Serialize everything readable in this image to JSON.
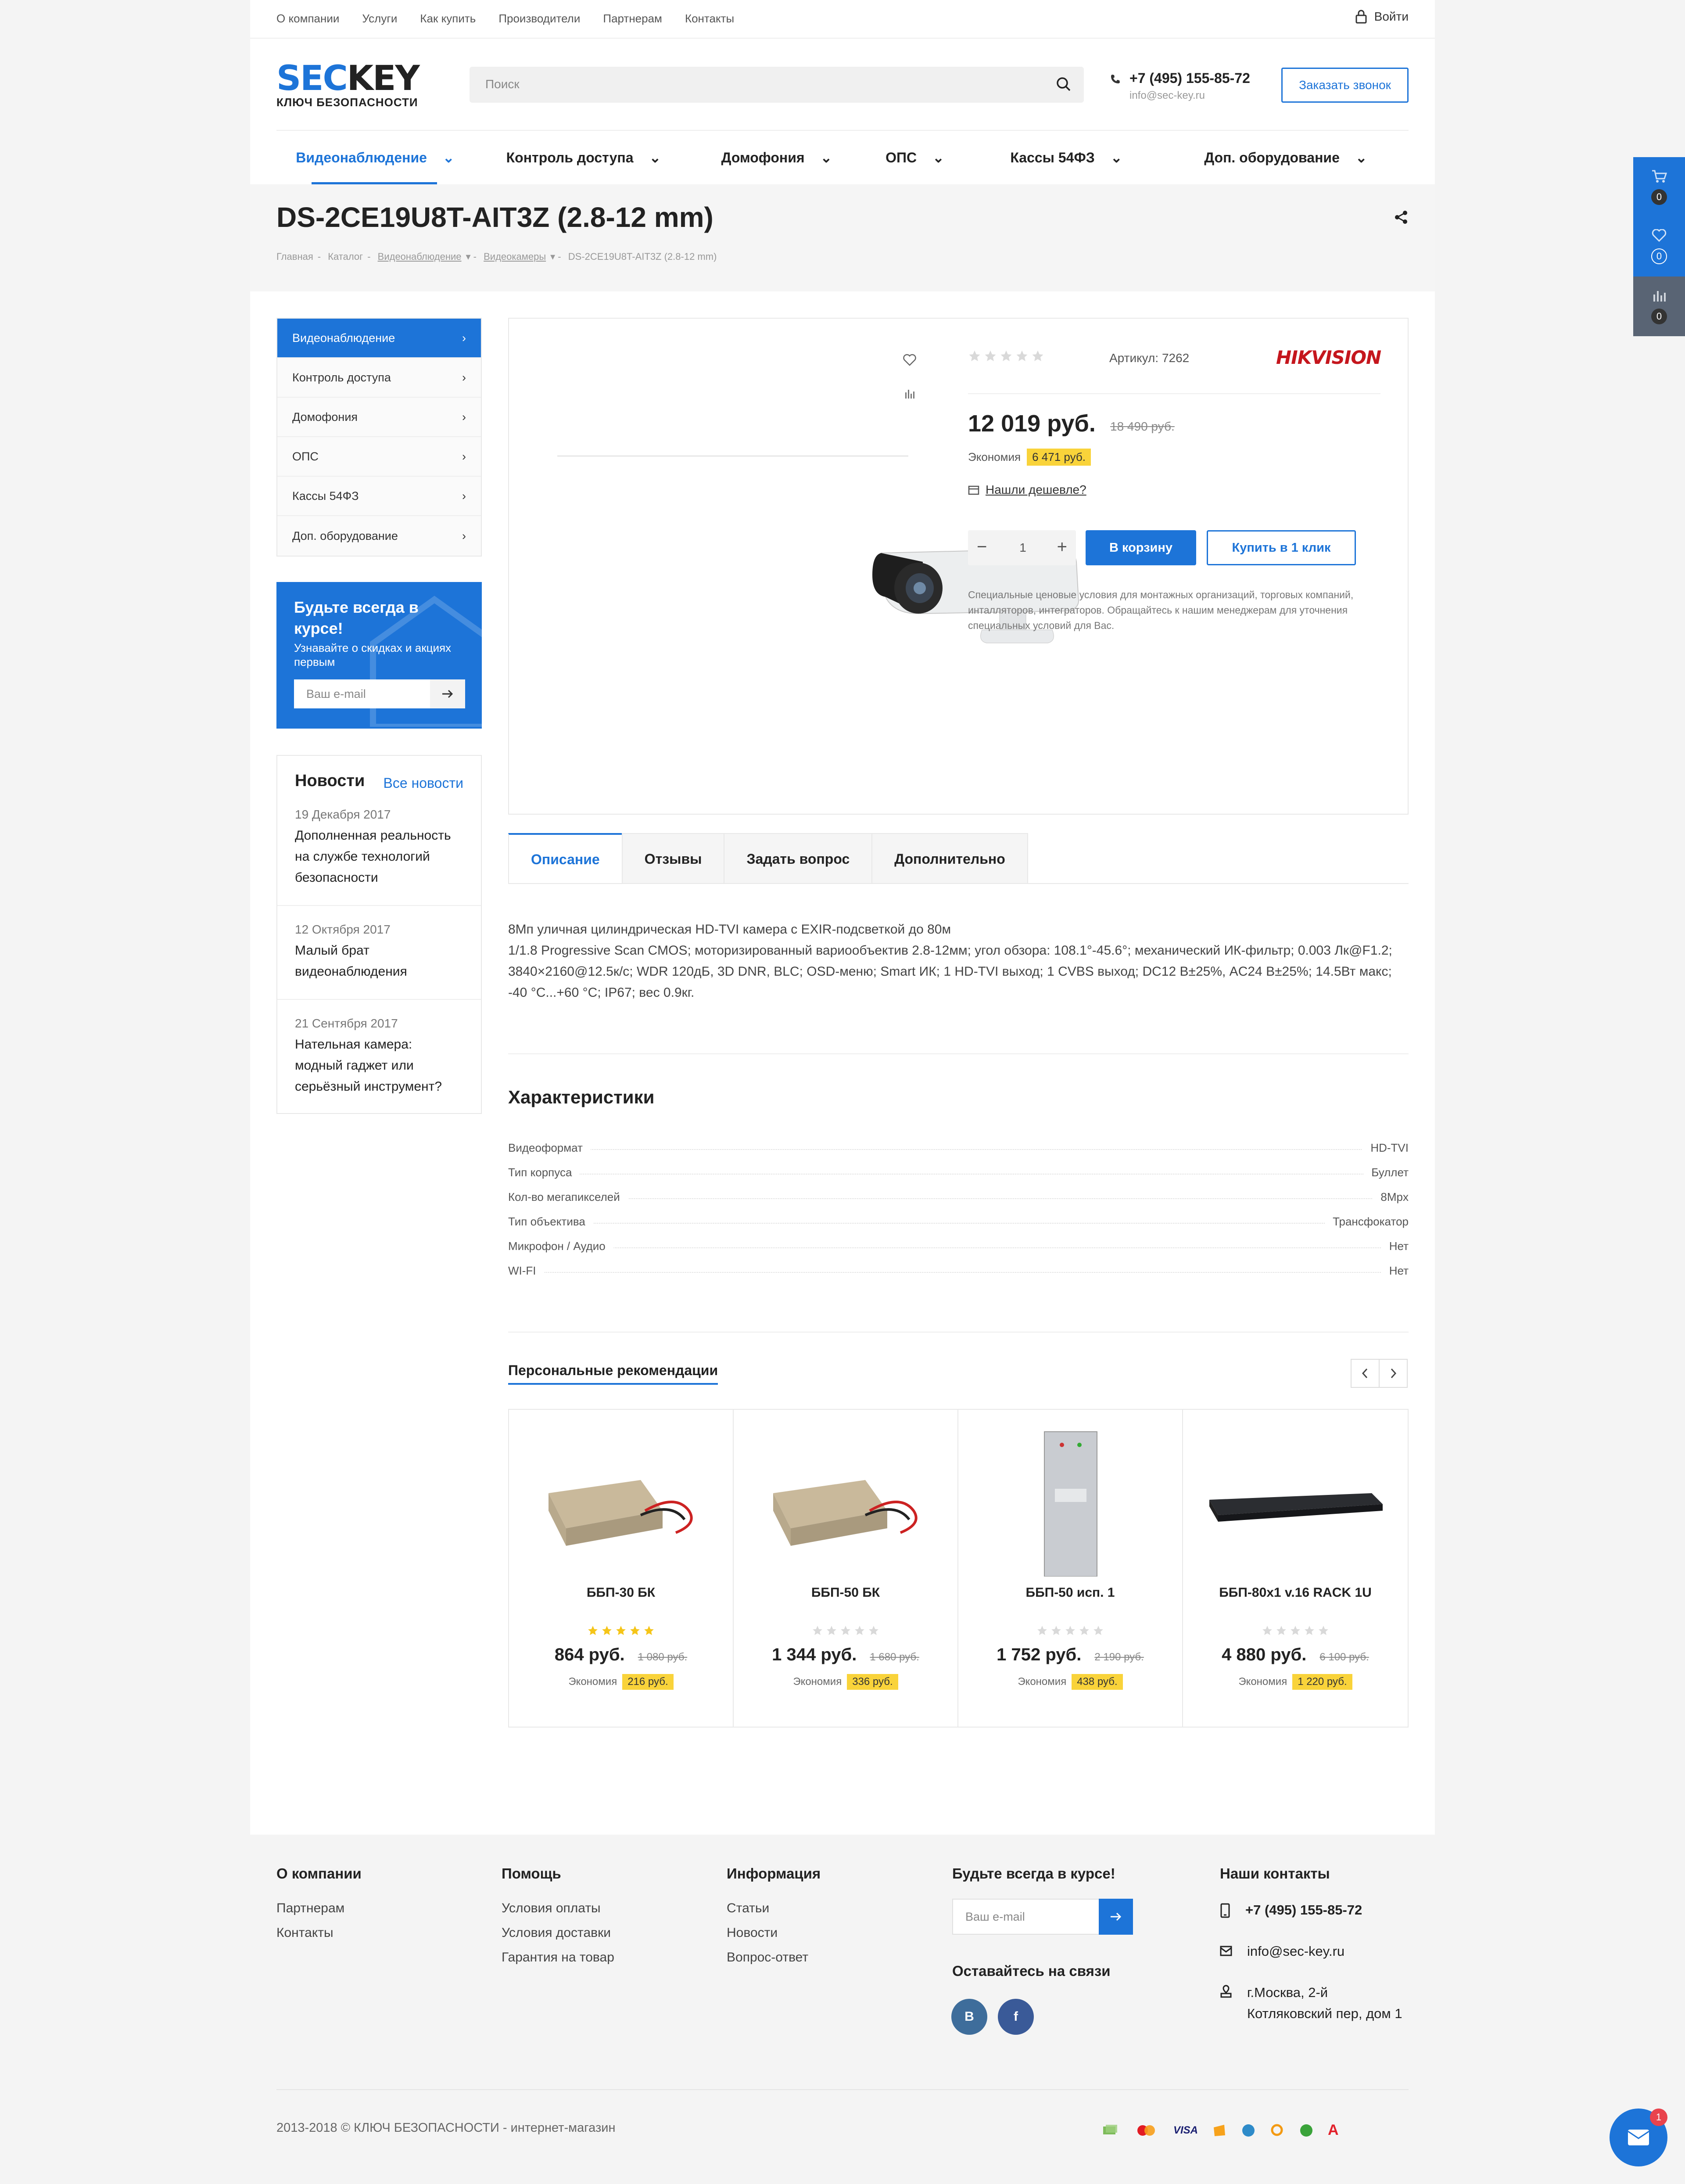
{
  "topnav": {
    "links": [
      "О компании",
      "Услуги",
      "Как купить",
      "Производители",
      "Партнерам",
      "Контакты"
    ],
    "login": "Войти"
  },
  "logo": {
    "brand_a": "SEC",
    "brand_b": "KEY",
    "tagline": "КЛЮЧ БЕЗОПАСНОСТИ"
  },
  "search": {
    "placeholder": "Поиск"
  },
  "contact": {
    "phone": "+7 (495) 155-85-72",
    "email": "info@sec-key.ru",
    "callback": "Заказать звонок"
  },
  "mainmenu": [
    "Видеонаблюдение",
    "Контроль доступа",
    "Домофония",
    "ОПС",
    "Кассы 54ФЗ",
    "Доп. оборудование"
  ],
  "product": {
    "title": "DS-2CE19U8T-AIT3Z (2.8-12 mm)",
    "breadcrumbs": [
      "Главная",
      "Каталог",
      "Видеонаблюдение",
      "Видеокамеры",
      "DS-2CE19U8T-AIT3Z (2.8-12 mm)"
    ],
    "artikul": "Артикул: 7262",
    "brand": "HIKVISION",
    "price": "12 019 руб.",
    "old_price": "18 490 руб.",
    "economy_label": "Экономия",
    "economy_value": "6 471 руб.",
    "cheaper": "Нашли дешевле?",
    "qty": "1",
    "cart_btn": "В корзину",
    "oneclick_btn": "Купить в 1 клик",
    "special": "Специальные ценовые условия для монтажных организаций, торговых компаний, инталляторов, интеграторов. Обращайтесь к нашим менеджерам для уточнения специальных условий для Вас."
  },
  "sidebar": {
    "items": [
      "Видеонаблюдение",
      "Контроль доступа",
      "Домофония",
      "ОПС",
      "Кассы 54ФЗ",
      "Доп. оборудование"
    ]
  },
  "subscribe": {
    "title": "Будьте всегда в курсе!",
    "text": "Узнавайте о скидках и акциях первым",
    "placeholder": "Ваш e-mail"
  },
  "news": {
    "title": "Новости",
    "all": "Все новости",
    "items": [
      {
        "date": "19 Декабря 2017",
        "title": "Дополненная реальность на службе технологий безопасности"
      },
      {
        "date": "12 Октября 2017",
        "title": "Малый брат видеонаблюдения"
      },
      {
        "date": "21 Сентября 2017",
        "title": "Нательная камера: модный гаджет или серьёзный инструмент?"
      }
    ]
  },
  "tabs": [
    "Описание",
    "Отзывы",
    "Задать вопрос",
    "Дополнительно"
  ],
  "description": {
    "line1": "8Мп уличная цилиндрическая HD-TVI камера с EXIR-подсветкой до 80м",
    "line2": "1/1.8 Progressive Scan CMOS; моторизированный вариообъектив 2.8-12мм; угол обзора: 108.1°-45.6°; механический ИК-фильтр; 0.003 Лк@F1.2; 3840×2160@12.5к/с; WDR 120дБ, 3D DNR, BLC; OSD-меню; Smart ИК; 1 HD-TVI выход; 1 CVBS выход; DC12 В±25%, AC24 В±25%; 14.5Вт макс; -40 °C...+60 °C; IP67; вес 0.9кг."
  },
  "specs": {
    "title": "Характеристики",
    "rows": [
      {
        "k": "Видеоформат",
        "v": "HD-TVI"
      },
      {
        "k": "Тип корпуса",
        "v": "Буллет"
      },
      {
        "k": "Кол-во мегапикселей",
        "v": "8Mpx"
      },
      {
        "k": "Тип объектива",
        "v": "Трансфокатор"
      },
      {
        "k": "Микрофон / Аудио",
        "v": "Нет"
      },
      {
        "k": "WI-FI",
        "v": "Нет"
      }
    ]
  },
  "recommendations": {
    "title": "Персональные рекомендации",
    "items": [
      {
        "name": "ББП-30 БК",
        "price": "864 руб.",
        "old": "1 080 руб.",
        "econ": "216 руб.",
        "rating": 5
      },
      {
        "name": "ББП-50 БК",
        "price": "1 344 руб.",
        "old": "1 680 руб.",
        "econ": "336 руб.",
        "rating": 0
      },
      {
        "name": "ББП-50 исп. 1",
        "price": "1 752 руб.",
        "old": "2 190 руб.",
        "econ": "438 руб.",
        "rating": 0
      },
      {
        "name": "ББП-80х1 v.16 RACK 1U",
        "price": "4 880 руб.",
        "old": "6 100 руб.",
        "econ": "1 220 руб.",
        "rating": 0
      }
    ],
    "econ_label": "Экономия"
  },
  "footer": {
    "col1": {
      "title": "О компании",
      "links": [
        "Партнерам",
        "Контакты"
      ]
    },
    "col2": {
      "title": "Помощь",
      "links": [
        "Условия оплаты",
        "Условия доставки",
        "Гарантия на товар"
      ]
    },
    "col3": {
      "title": "Информация",
      "links": [
        "Статьи",
        "Новости",
        "Вопрос-ответ"
      ]
    },
    "col4": {
      "title": "Будьте всегда в курсе!",
      "placeholder": "Ваш e-mail",
      "social_title": "Оставайтесь на связи"
    },
    "col5": {
      "title": "Наши контакты",
      "phone": "+7 (495) 155-85-72",
      "email": "info@sec-key.ru",
      "address": "г.Москва, 2-й Котляковский пер, дом 1"
    },
    "copyright": "2013-2018 © КЛЮЧ БЕЗОПАСНОСТИ - интернет-магазин"
  },
  "right_panel": {
    "cart": "0",
    "fav": "0",
    "compare": "0"
  },
  "chat_badge": "1",
  "colors": {
    "accent": "#1d74d8",
    "badge": "#f9d33a",
    "panel": "#596474"
  }
}
